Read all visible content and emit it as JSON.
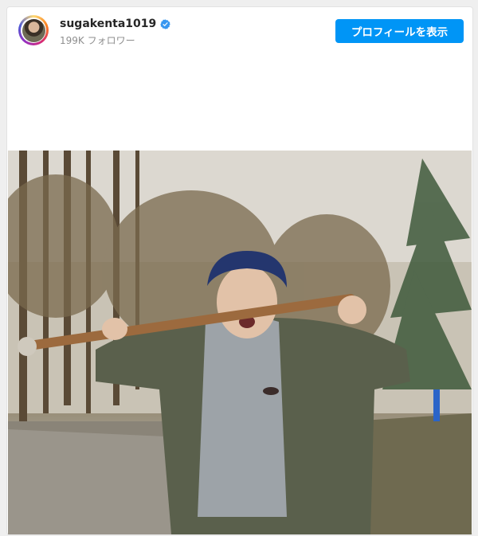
{
  "post": {
    "username": "sugakenta1019",
    "followers": "199K フォロワー",
    "profile_button_label": "プロフィールを表示",
    "verified": true,
    "photo_description_icon": "post-photo"
  },
  "colors": {
    "button": "#0095f6",
    "verified": "#3897f0"
  }
}
